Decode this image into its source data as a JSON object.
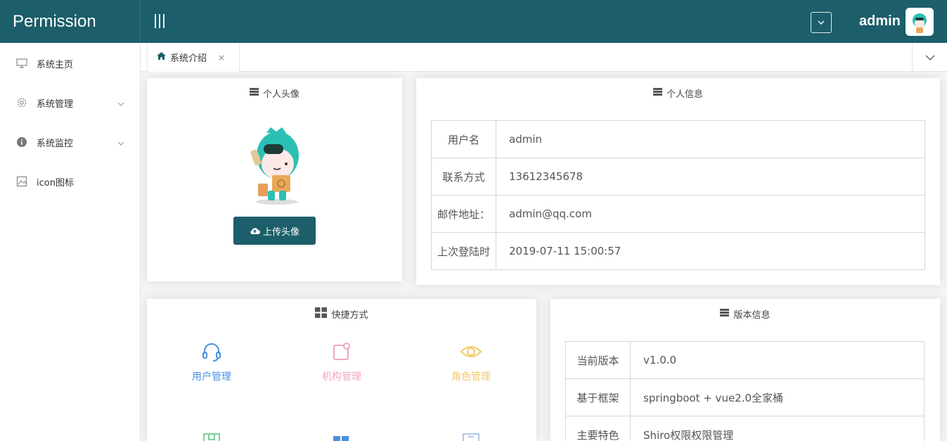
{
  "app": {
    "brand": "Permission",
    "username": "admin"
  },
  "sidebar": {
    "items": [
      {
        "label": "系统主页",
        "icon": "monitor-icon"
      },
      {
        "label": "系统管理",
        "icon": "gear-icon"
      },
      {
        "label": "系统监控",
        "icon": "info-icon"
      },
      {
        "label": "icon图标",
        "icon": "image-icon"
      }
    ]
  },
  "tabs": [
    {
      "label": "系统介绍",
      "icon": "home-icon",
      "close": "×"
    }
  ],
  "avatar_card": {
    "title": "个人头像",
    "upload_label": "上传头像"
  },
  "personal_info": {
    "title": "个人信息",
    "rows": [
      {
        "key": "用户名",
        "value": "admin"
      },
      {
        "key": "联系方式",
        "value": "13612345678"
      },
      {
        "key": "邮件地址：",
        "value": "admin@qq.com"
      },
      {
        "key": "上次登陆时",
        "value": "2019-07-11 15:00:57"
      }
    ]
  },
  "shortcuts": {
    "title": "快捷方式",
    "items": [
      {
        "label": "用户管理",
        "icon": "headset-icon",
        "color": "#4a90e2"
      },
      {
        "label": "机构管理",
        "icon": "org-icon",
        "color": "#f0a6c4"
      },
      {
        "label": "角色管理",
        "icon": "eye-icon",
        "color": "#f3c969"
      }
    ]
  },
  "version_info": {
    "title": "版本信息",
    "rows": [
      {
        "key": "当前版本",
        "value": "v1.0.0"
      },
      {
        "key": "基于框架",
        "value": "springboot + vue2.0全家桶"
      },
      {
        "key": "主要特色",
        "value": "Shiro权限权限管理"
      }
    ]
  },
  "colors": {
    "primary": "#1c5e6a",
    "background": "#f4f4f4"
  }
}
